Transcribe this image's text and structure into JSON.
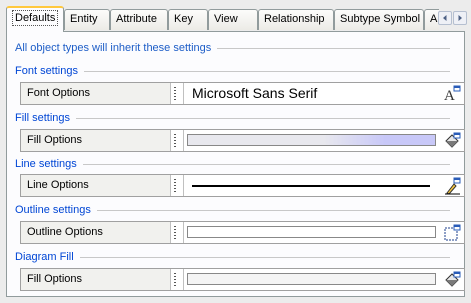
{
  "tabs": [
    {
      "label": "Defaults",
      "active": true
    },
    {
      "label": "Entity"
    },
    {
      "label": "Attribute"
    },
    {
      "label": "Key"
    },
    {
      "label": "View"
    },
    {
      "label": "Relationship"
    },
    {
      "label": "Subtype Symbol"
    },
    {
      "label": "A"
    }
  ],
  "panel": {
    "intro": "All object types will inherit these settings",
    "font": {
      "section": "Font settings",
      "name": "Font Options",
      "value": "Microsoft Sans Serif",
      "button_icon": "font-picker-icon"
    },
    "fill": {
      "section": "Fill settings",
      "name": "Fill Options",
      "button_icon": "fill-bucket-icon",
      "colors": [
        "#e8e8ee",
        "#c8c8f8"
      ]
    },
    "line": {
      "section": "Line settings",
      "name": "Line Options",
      "button_icon": "pen-icon",
      "color": "#000000"
    },
    "outline": {
      "section": "Outline settings",
      "name": "Outline Options",
      "button_icon": "outline-icon"
    },
    "diagram": {
      "section": "Diagram Fill",
      "name": "Fill Options",
      "button_icon": "fill-bucket-icon",
      "color": "#f4f4f4"
    }
  },
  "colors": {
    "section_header": "#0046d5",
    "active_tab_accent": "#ffc83c"
  }
}
